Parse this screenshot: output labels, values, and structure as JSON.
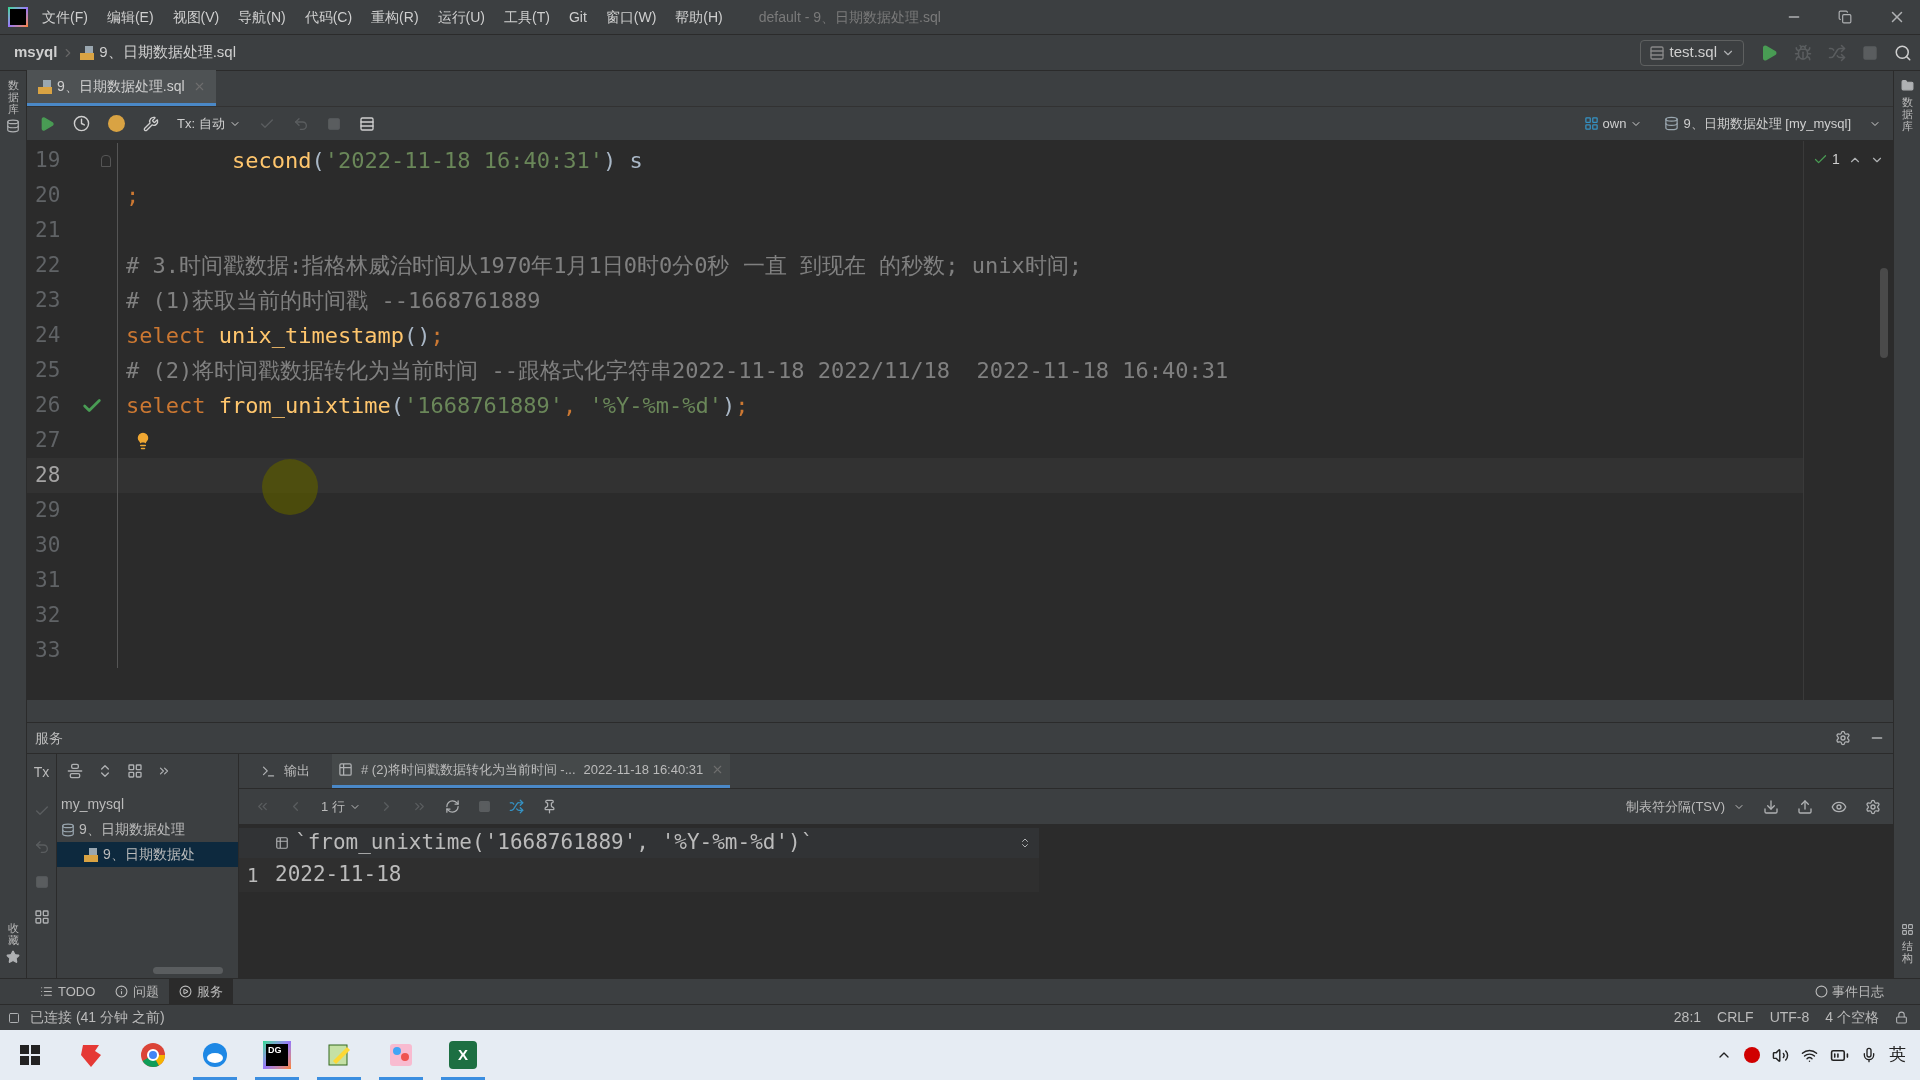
{
  "menu": [
    "文件(F)",
    "编辑(E)",
    "视图(V)",
    "导航(N)",
    "代码(C)",
    "重构(R)",
    "运行(U)",
    "工具(T)",
    "Git",
    "窗口(W)",
    "帮助(H)"
  ],
  "window": {
    "title": "default - 9、日期数据处理.sql"
  },
  "breadcrumb": {
    "project": "msyql",
    "file": "9、日期数据处理.sql"
  },
  "run_config": {
    "label": "test.sql"
  },
  "editor_tabs": [
    {
      "label": "9、日期数据处理.sql",
      "selected": true
    }
  ],
  "left_strip": {
    "top": "数据库",
    "bottom": "收藏"
  },
  "right_strip": {
    "top": "数据库",
    "bottom": "结构"
  },
  "editor_toolbar": {
    "tx_mode": "Tx: 自动",
    "schema": "own",
    "session": "9、日期数据处理 [my_mysql]",
    "problems": "1"
  },
  "editor": {
    "lines": [
      {
        "number": "19",
        "current": false,
        "kind": "fold",
        "tokens": [
          {
            "kind": "func",
            "text": "second",
            "indent": true
          },
          {
            "kind": "plain",
            "text": "("
          },
          {
            "kind": "string",
            "text": "'2022-11-18 16:40:31'"
          },
          {
            "kind": "plain",
            "text": ") s"
          }
        ]
      },
      {
        "number": "20",
        "current": false,
        "kind": "plain",
        "tokens": [
          {
            "kind": "keyword",
            "text": ";"
          }
        ]
      },
      {
        "number": "21",
        "current": false,
        "kind": "plain"
      },
      {
        "number": "22",
        "current": false,
        "kind": "plain",
        "tokens": [
          {
            "kind": "comment",
            "text": "# 3.时间戳数据:指格林威治时间从1970年1月1日0时0分0秒 一直 到现在 的秒数; unix时间;"
          }
        ]
      },
      {
        "number": "23",
        "current": false,
        "kind": "plain",
        "tokens": [
          {
            "kind": "comment",
            "text": "# (1)获取当前的时间戳 --1668761889"
          }
        ]
      },
      {
        "number": "24",
        "current": false,
        "kind": "plain",
        "tokens": [
          {
            "kind": "keyword",
            "text": "select"
          },
          {
            "kind": "func",
            "text": "unix_timestamp",
            "space_before": true
          },
          {
            "kind": "plain",
            "text": "()"
          },
          {
            "kind": "keyword",
            "text": ";"
          }
        ]
      },
      {
        "number": "25",
        "current": false,
        "kind": "plain",
        "tokens": [
          {
            "kind": "comment",
            "text": "# (2)将时间戳数据转化为当前时间 --跟格式化字符串2022-11-18 2022/11/18  2022-11-18 16:40:31"
          }
        ]
      },
      {
        "number": "26",
        "current": false,
        "kind": "check",
        "tokens": [
          {
            "kind": "keyword",
            "text": "select"
          },
          {
            "kind": "func",
            "text": "from_unixtime",
            "space_before": true
          },
          {
            "kind": "plain",
            "text": "("
          },
          {
            "kind": "string",
            "text": "'1668761889'"
          },
          {
            "kind": "keyword",
            "text": ","
          },
          {
            "kind": "string",
            "text": "'%Y-%m-%d'",
            "space_before": true
          },
          {
            "kind": "plain",
            "text": ")"
          },
          {
            "kind": "keyword",
            "text": ";"
          }
        ]
      },
      {
        "number": "27",
        "current": false,
        "kind": "bulb"
      },
      {
        "number": "28",
        "current": true,
        "kind": "plain"
      },
      {
        "number": "29",
        "current": false,
        "kind": "plain"
      },
      {
        "number": "30",
        "current": false,
        "kind": "plain"
      },
      {
        "number": "31",
        "current": false,
        "kind": "plain"
      },
      {
        "number": "32",
        "current": false,
        "kind": "plain"
      },
      {
        "number": "33",
        "current": false,
        "kind": "plain"
      }
    ]
  },
  "services": {
    "title": "服务",
    "tx_label": "Tx",
    "tree": [
      {
        "label": "my_mysql",
        "selected": false,
        "children": [
          {
            "label": "9、日期数据处理",
            "selected": false,
            "children": [
              {
                "label": "9、日期数据处",
                "selected": true
              }
            ]
          }
        ]
      }
    ],
    "tabs": [
      {
        "label": "输出",
        "selected": false
      },
      {
        "label": "# (2)将时间戳数据转化为当前时间 -...",
        "time": "2022-11-18 16:40:31",
        "selected": true
      }
    ],
    "row_count": "1 行",
    "export_format": "制表符分隔(TSV)",
    "result": {
      "columns": [
        "`from_unixtime('1668761889', '%Y-%m-%d')`"
      ],
      "rows": [
        {
          "number": "1",
          "cells": [
            "2022-11-18"
          ]
        }
      ]
    }
  },
  "tool_tabs": [
    {
      "label": "TODO",
      "kind": "list",
      "selected": false
    },
    {
      "label": "问题",
      "kind": "problems",
      "selected": false
    },
    {
      "label": "服务",
      "kind": "services",
      "selected": true
    }
  ],
  "event_log": "事件日志",
  "status_bar": {
    "message": "已连接 (41 分钟 之前)",
    "position": "28:1",
    "line_ending": "CRLF",
    "encoding": "UTF-8",
    "indent": "4 个空格"
  },
  "taskbar": {
    "apps": [
      {
        "kind": "fox",
        "running": false
      },
      {
        "kind": "chrome",
        "running": false
      },
      {
        "kind": "browser",
        "running": true
      },
      {
        "kind": "datagrip",
        "label": "DG",
        "running": true
      },
      {
        "kind": "notepad",
        "running": true
      },
      {
        "kind": "paint",
        "running": true
      },
      {
        "kind": "excel",
        "label": "X",
        "running": true
      }
    ],
    "ime": "英"
  }
}
